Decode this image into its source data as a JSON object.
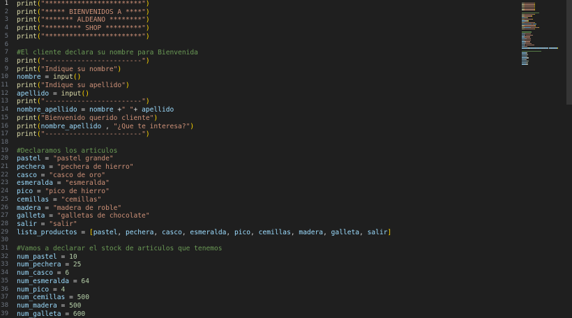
{
  "editor": {
    "active_line": 1,
    "lines": [
      {
        "n": "1",
        "t": [
          [
            "fn",
            "print"
          ],
          [
            "p1",
            "("
          ],
          [
            "str",
            "\"************************\""
          ],
          [
            "p1",
            ")"
          ]
        ]
      },
      {
        "n": "2",
        "t": [
          [
            "fn",
            "print"
          ],
          [
            "p1",
            "("
          ],
          [
            "str",
            "\"***** BIENVENIDOS A ****\""
          ],
          [
            "p1",
            ")"
          ]
        ]
      },
      {
        "n": "3",
        "t": [
          [
            "fn",
            "print"
          ],
          [
            "p1",
            "("
          ],
          [
            "str",
            "\"******* ALDEANO ********\""
          ],
          [
            "p1",
            ")"
          ]
        ]
      },
      {
        "n": "4",
        "t": [
          [
            "fn",
            "print"
          ],
          [
            "p1",
            "("
          ],
          [
            "str",
            "\"********* SHOP *********\""
          ],
          [
            "p1",
            ")"
          ]
        ]
      },
      {
        "n": "5",
        "t": [
          [
            "fn",
            "print"
          ],
          [
            "p1",
            "("
          ],
          [
            "str",
            "\"************************\""
          ],
          [
            "p1",
            ")"
          ]
        ]
      },
      {
        "n": "6",
        "t": []
      },
      {
        "n": "7",
        "t": [
          [
            "cmt",
            "#El cliente declara su nombre para Bienvenida"
          ]
        ]
      },
      {
        "n": "8",
        "t": [
          [
            "fn",
            "print"
          ],
          [
            "p1",
            "("
          ],
          [
            "str",
            "\"------------------------\""
          ],
          [
            "p1",
            ")"
          ]
        ]
      },
      {
        "n": "9",
        "t": [
          [
            "fn",
            "print"
          ],
          [
            "p1",
            "("
          ],
          [
            "str",
            "\"Indique su nombre\""
          ],
          [
            "p1",
            ")"
          ]
        ]
      },
      {
        "n": "10",
        "t": [
          [
            "var",
            "nombre"
          ],
          [
            "op",
            " = "
          ],
          [
            "fn",
            "input"
          ],
          [
            "p1",
            "()"
          ]
        ]
      },
      {
        "n": "11",
        "t": [
          [
            "fn",
            "print"
          ],
          [
            "p1",
            "("
          ],
          [
            "str",
            "\"Indique su apellido\""
          ],
          [
            "p1",
            ")"
          ]
        ]
      },
      {
        "n": "12",
        "t": [
          [
            "var",
            "apellido"
          ],
          [
            "op",
            " = "
          ],
          [
            "fn",
            "input"
          ],
          [
            "p1",
            "()"
          ]
        ]
      },
      {
        "n": "13",
        "t": [
          [
            "fn",
            "print"
          ],
          [
            "p1",
            "("
          ],
          [
            "str",
            "\"------------------------\""
          ],
          [
            "p1",
            ")"
          ]
        ]
      },
      {
        "n": "14",
        "t": [
          [
            "var",
            "nombre_apellido"
          ],
          [
            "op",
            " = "
          ],
          [
            "var",
            "nombre"
          ],
          [
            "op",
            " +"
          ],
          [
            "str",
            "\" \""
          ],
          [
            "op",
            "+ "
          ],
          [
            "var",
            "apellido"
          ]
        ]
      },
      {
        "n": "15",
        "t": [
          [
            "fn",
            "print"
          ],
          [
            "p1",
            "("
          ],
          [
            "str",
            "\"Bienvenido querido cliente\""
          ],
          [
            "p1",
            ")"
          ]
        ]
      },
      {
        "n": "16",
        "t": [
          [
            "fn",
            "print"
          ],
          [
            "p1",
            "("
          ],
          [
            "var",
            "nombre_apellido"
          ],
          [
            "op",
            " , "
          ],
          [
            "str",
            "\"¿Que te interesa?\""
          ],
          [
            "p1",
            ")"
          ]
        ]
      },
      {
        "n": "17",
        "t": [
          [
            "fn",
            "print"
          ],
          [
            "p1",
            "("
          ],
          [
            "str",
            "\"------------------------\""
          ],
          [
            "p1",
            ")"
          ]
        ]
      },
      {
        "n": "18",
        "t": []
      },
      {
        "n": "19",
        "t": [
          [
            "cmt",
            "#Declaramos los articulos"
          ]
        ]
      },
      {
        "n": "20",
        "t": [
          [
            "var",
            "pastel"
          ],
          [
            "op",
            " = "
          ],
          [
            "str",
            "\"pastel grande\""
          ]
        ]
      },
      {
        "n": "21",
        "t": [
          [
            "var",
            "pechera"
          ],
          [
            "op",
            " = "
          ],
          [
            "str",
            "\"pechera de hierro\""
          ]
        ]
      },
      {
        "n": "22",
        "t": [
          [
            "var",
            "casco"
          ],
          [
            "op",
            " = "
          ],
          [
            "str",
            "\"casco de oro\""
          ]
        ]
      },
      {
        "n": "23",
        "t": [
          [
            "var",
            "esmeralda"
          ],
          [
            "op",
            " = "
          ],
          [
            "str",
            "\"esmeralda\""
          ]
        ]
      },
      {
        "n": "24",
        "t": [
          [
            "var",
            "pico"
          ],
          [
            "op",
            " = "
          ],
          [
            "str",
            "\"pico de hierro\""
          ]
        ]
      },
      {
        "n": "25",
        "t": [
          [
            "var",
            "cemillas"
          ],
          [
            "op",
            " = "
          ],
          [
            "str",
            "\"cemillas\""
          ]
        ]
      },
      {
        "n": "26",
        "t": [
          [
            "var",
            "madera"
          ],
          [
            "op",
            " = "
          ],
          [
            "str",
            "\"madera de roble\""
          ]
        ]
      },
      {
        "n": "27",
        "t": [
          [
            "var",
            "galleta"
          ],
          [
            "op",
            " = "
          ],
          [
            "str",
            "\"galletas de chocolate\""
          ]
        ]
      },
      {
        "n": "28",
        "t": [
          [
            "var",
            "salir"
          ],
          [
            "op",
            " = "
          ],
          [
            "str",
            "\"salir\""
          ]
        ]
      },
      {
        "n": "29",
        "t": [
          [
            "var",
            "lista_productos"
          ],
          [
            "op",
            " = "
          ],
          [
            "p1",
            "["
          ],
          [
            "var",
            "pastel"
          ],
          [
            "op",
            ", "
          ],
          [
            "var",
            "pechera"
          ],
          [
            "op",
            ", "
          ],
          [
            "var",
            "casco"
          ],
          [
            "op",
            ", "
          ],
          [
            "var",
            "esmeralda"
          ],
          [
            "op",
            ", "
          ],
          [
            "var",
            "pico"
          ],
          [
            "op",
            ", "
          ],
          [
            "var",
            "cemillas"
          ],
          [
            "op",
            ", "
          ],
          [
            "var",
            "madera"
          ],
          [
            "op",
            ", "
          ],
          [
            "var",
            "galleta"
          ],
          [
            "op",
            ", "
          ],
          [
            "var",
            "salir"
          ],
          [
            "p1",
            "]"
          ]
        ]
      },
      {
        "n": "30",
        "t": []
      },
      {
        "n": "31",
        "t": [
          [
            "cmt",
            "#Vamos a declarar el stock de articulos que tenemos"
          ]
        ]
      },
      {
        "n": "32",
        "t": [
          [
            "var",
            "num_pastel"
          ],
          [
            "op",
            " = "
          ],
          [
            "num",
            "10"
          ]
        ]
      },
      {
        "n": "33",
        "t": [
          [
            "var",
            "num_pechera"
          ],
          [
            "op",
            " = "
          ],
          [
            "num",
            "25"
          ]
        ]
      },
      {
        "n": "34",
        "t": [
          [
            "var",
            "num_casco"
          ],
          [
            "op",
            " = "
          ],
          [
            "num",
            "6"
          ]
        ]
      },
      {
        "n": "35",
        "t": [
          [
            "var",
            "num_esmeralda"
          ],
          [
            "op",
            " = "
          ],
          [
            "num",
            "64"
          ]
        ]
      },
      {
        "n": "36",
        "t": [
          [
            "var",
            "num_pico"
          ],
          [
            "op",
            " = "
          ],
          [
            "num",
            "4"
          ]
        ]
      },
      {
        "n": "37",
        "t": [
          [
            "var",
            "num_cemillas"
          ],
          [
            "op",
            " = "
          ],
          [
            "num",
            "500"
          ]
        ]
      },
      {
        "n": "38",
        "t": [
          [
            "var",
            "num_madera"
          ],
          [
            "op",
            " = "
          ],
          [
            "num",
            "500"
          ]
        ]
      },
      {
        "n": "39",
        "t": [
          [
            "var",
            "num_galleta"
          ],
          [
            "op",
            " = "
          ],
          [
            "num",
            "600"
          ]
        ]
      }
    ]
  },
  "colors": {
    "background": "#1f1f1f",
    "function": "#dcdcaa",
    "string": "#ce9178",
    "variable": "#9cdcfe",
    "number": "#b5cea8",
    "comment": "#6a9955",
    "bracket": "#ffd700"
  }
}
